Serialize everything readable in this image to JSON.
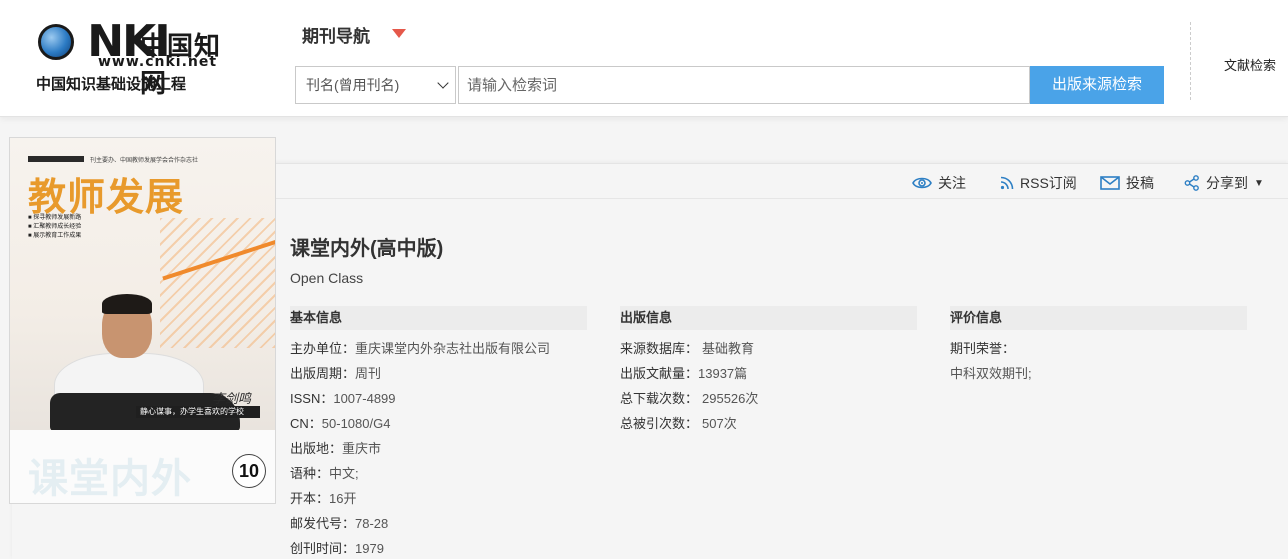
{
  "header": {
    "logo": {
      "brand": "CNKI",
      "cn_name": "中国知网",
      "url": "www.cnki.net",
      "slogan": "中国知识基础设施工程"
    },
    "nav_title": "期刊导航",
    "search": {
      "field_select": "刊名(曾用刊名)",
      "placeholder": "请输入检索词",
      "button": "出版来源检索"
    },
    "doc_search": "文献检索"
  },
  "toolbar": {
    "follow": "关注",
    "rss": "RSS订阅",
    "submit": "投稿",
    "share": "分享到"
  },
  "cover": {
    "title": "教师发展",
    "small_header": "刊主要办、中国教师发展学会合作杂志社",
    "bullets": [
      "■ 探寻教师发展新路",
      "■ 汇聚教师成长经验",
      "■ 展示教育工作成果"
    ],
    "caption": "静心谋事，办学生喜欢的学校",
    "signature": "李剑鸣",
    "magazine_name": "课堂内外",
    "issue": "10"
  },
  "journal": {
    "title": "课堂内外(高中版)",
    "english": "Open Class"
  },
  "sections": {
    "basic": {
      "heading": "基本信息",
      "fields": [
        {
          "label": "主办单位：",
          "value": "重庆课堂内外杂志社出版有限公司"
        },
        {
          "label": "出版周期：",
          "value": "周刊"
        },
        {
          "label": "ISSN：",
          "value": "1007-4899"
        },
        {
          "label": "CN：",
          "value": "50-1080/G4"
        },
        {
          "label": "出版地：",
          "value": "重庆市"
        },
        {
          "label": "语种：",
          "value": "中文;"
        },
        {
          "label": "开本：",
          "value": "16开"
        },
        {
          "label": "邮发代号：",
          "value": "78-28"
        },
        {
          "label": "创刊时间：",
          "value": "1979"
        }
      ]
    },
    "publish": {
      "heading": "出版信息",
      "fields": [
        {
          "label": "来源数据库：",
          "value": "基础教育"
        },
        {
          "label": "出版文献量：",
          "value": "13937篇"
        },
        {
          "label": "总下载次数：",
          "value": "295526次"
        },
        {
          "label": "总被引次数：",
          "value": "507次"
        }
      ]
    },
    "rating": {
      "heading": "评价信息",
      "fields": [
        {
          "label": "期刊荣誉：",
          "value": ""
        },
        {
          "label": "",
          "value": "中科双效期刊;"
        }
      ]
    }
  }
}
